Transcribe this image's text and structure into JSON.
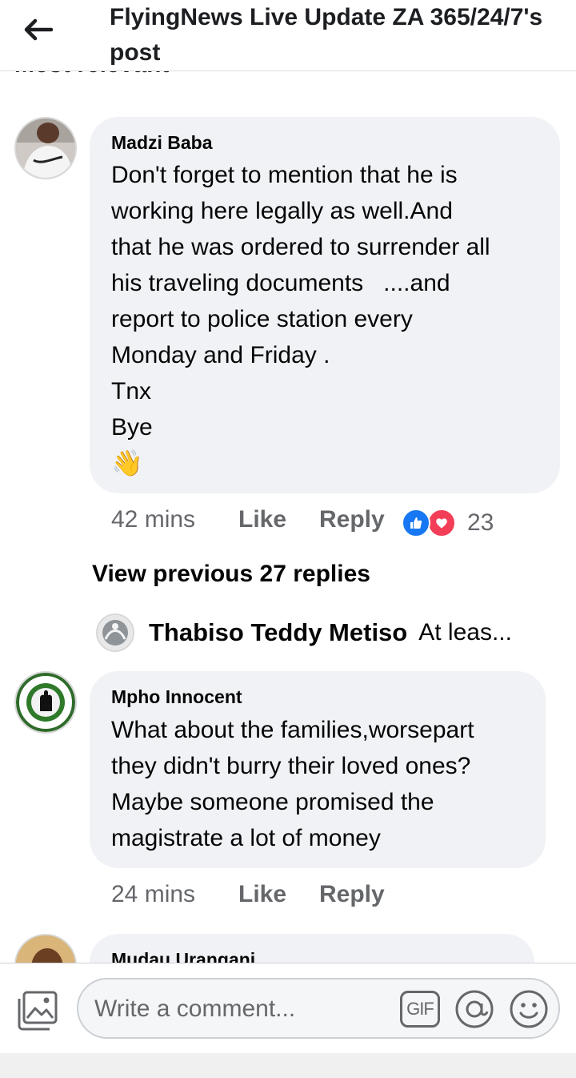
{
  "header": {
    "title": "FlyingNews Live Update ZA 365/24/7's post"
  },
  "sort": {
    "label": "Most relevant"
  },
  "comments": [
    {
      "author": "Madzi Baba",
      "text_lines": [
        "Don't forget to mention that he is",
        "working here legally as well.And",
        "that he was ordered to surrender all",
        "his traveling documents   ....and",
        "report to police station every",
        "Monday and Friday .",
        "Tnx",
        "Bye"
      ],
      "emoji": "👋",
      "time": "42 mins",
      "like_label": "Like",
      "reply_label": "Reply",
      "reaction_count": "23",
      "reaction_icons": [
        "like-icon",
        "love-icon"
      ]
    },
    {
      "author": "Mpho Innocent",
      "text_lines": [
        "What about the families,worsepart",
        "they didn't burry their loved ones?",
        "Maybe someone promised the",
        "magistrate a lot of money"
      ],
      "time": "24 mins",
      "like_label": "Like",
      "reply_label": "Reply"
    },
    {
      "author": "Mudau Urangani"
    }
  ],
  "replies": {
    "view_previous": "View previous 27 replies",
    "preview_author": "Thabiso Teddy Metiso",
    "preview_snippet": "At leas..."
  },
  "composer": {
    "placeholder": "Write a comment...",
    "gif_label": "GIF"
  },
  "colors": {
    "bubble": "#f0f2f5",
    "meta_text": "#65676b",
    "like_blue": "#1877f2",
    "love_red": "#f33e58"
  }
}
